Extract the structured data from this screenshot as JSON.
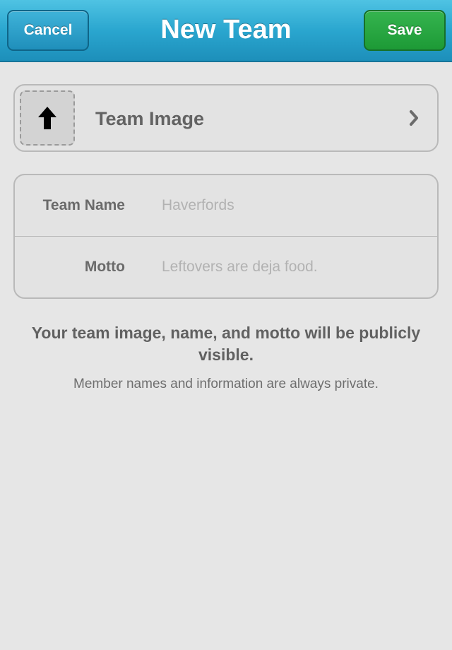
{
  "navbar": {
    "title": "New Team",
    "cancel_label": "Cancel",
    "save_label": "Save",
    "accent_color": "#2aa6cf",
    "save_color": "#1d9a36"
  },
  "team_image": {
    "label": "Team Image",
    "upload_icon": "up-arrow-icon",
    "chevron_icon": "chevron-right-icon"
  },
  "form": {
    "team_name": {
      "label": "Team Name",
      "placeholder": "Haverfords",
      "value": ""
    },
    "motto": {
      "label": "Motto",
      "placeholder": "Leftovers are deja food.",
      "value": ""
    }
  },
  "notice": {
    "primary": "Your team image, name, and motto will be publicly visible.",
    "secondary": "Member names and information are always private."
  }
}
